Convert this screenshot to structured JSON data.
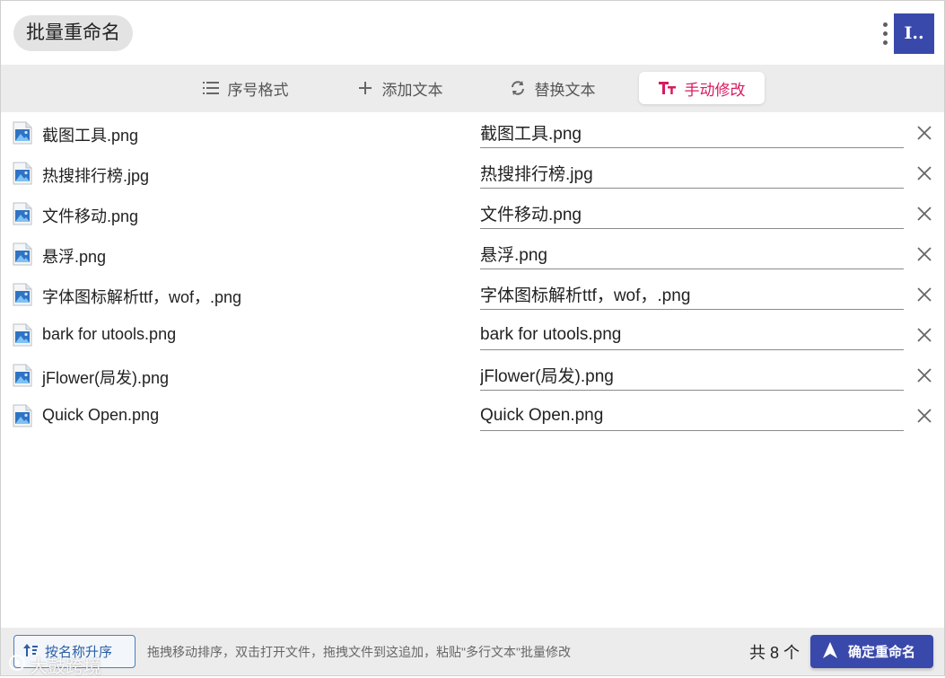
{
  "header": {
    "title": "批量重命名",
    "logo_text": "I.."
  },
  "tabs": [
    {
      "label": "序号格式",
      "icon": "list-numbered-icon"
    },
    {
      "label": "添加文本",
      "icon": "plus-icon"
    },
    {
      "label": "替换文本",
      "icon": "replace-icon"
    },
    {
      "label": "手动修改",
      "icon": "text-format-icon",
      "active": true
    }
  ],
  "files": [
    {
      "original": "截图工具.png",
      "new": "截图工具.png"
    },
    {
      "original": "热搜排行榜.jpg",
      "new": "热搜排行榜.jpg"
    },
    {
      "original": "文件移动.png",
      "new": "文件移动.png"
    },
    {
      "original": "悬浮.png",
      "new": "悬浮.png"
    },
    {
      "original": "字体图标解析ttf，wof，.png",
      "new": "字体图标解析ttf，wof，.png"
    },
    {
      "original": "bark for utools.png",
      "new": "bark for utools.png"
    },
    {
      "original": "jFlower(局发).png",
      "new": "jFlower(局发).png"
    },
    {
      "original": "Quick Open.png",
      "new": "Quick Open.png"
    }
  ],
  "footer": {
    "sort_label": "按名称升序",
    "hint": "拖拽移动排序，双击打开文件，拖拽文件到这追加，粘贴\"多行文本\"批量修改",
    "count": "共 8 个",
    "confirm_label": "确定重命名",
    "watermark": "大鼓跨境"
  },
  "colors": {
    "accent": "#3949ab",
    "active_tab": "#d81b60",
    "bar_bg": "#ececec"
  }
}
